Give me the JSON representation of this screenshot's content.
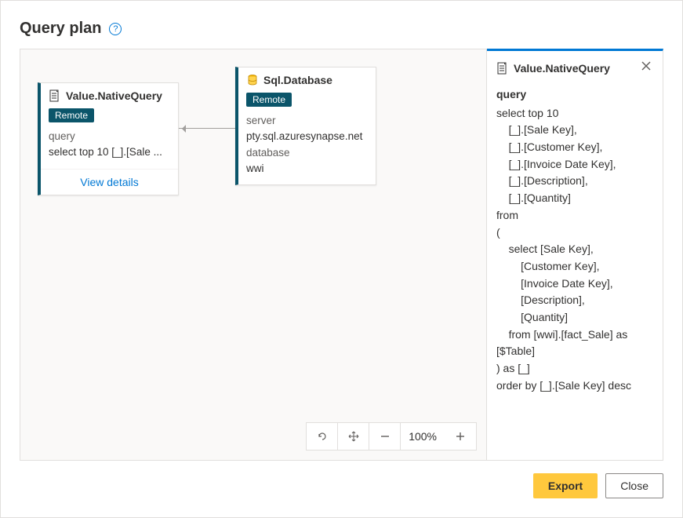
{
  "header": {
    "title": "Query plan"
  },
  "nodes": {
    "nativeQuery": {
      "title": "Value.NativeQuery",
      "badge": "Remote",
      "field_label": "query",
      "field_value": "select top 10 [_].[Sale ...",
      "view_details": "View details"
    },
    "sqlDatabase": {
      "title": "Sql.Database",
      "badge": "Remote",
      "field1_label": "server",
      "field1_value": "pty.sql.azuresynapse.net",
      "field2_label": "database",
      "field2_value": "wwi"
    }
  },
  "zoom": {
    "level": "100%"
  },
  "details": {
    "title": "Value.NativeQuery",
    "section_label": "query",
    "query_text": "select top 10\n    [_].[Sale Key],\n    [_].[Customer Key],\n    [_].[Invoice Date Key],\n    [_].[Description],\n    [_].[Quantity]\nfrom\n(\n    select [Sale Key],\n        [Customer Key],\n        [Invoice Date Key],\n        [Description],\n        [Quantity]\n    from [wwi].[fact_Sale] as [$Table]\n) as [_]\norder by [_].[Sale Key] desc"
  },
  "footer": {
    "export": "Export",
    "close": "Close"
  }
}
